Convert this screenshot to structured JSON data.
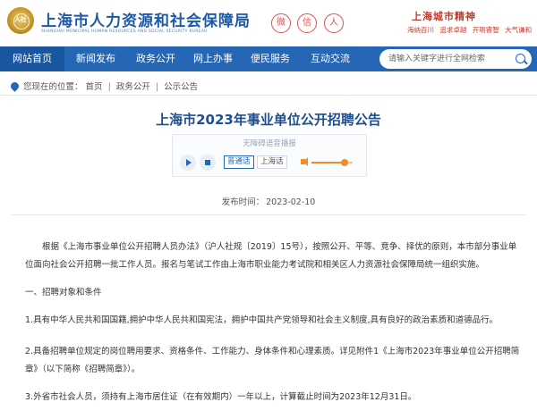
{
  "header": {
    "logo_text": "上海市人力资源和社会保障局",
    "logo_subtitle": "SHANGHAI MUNICIPAL HUMAN RESOURCES AND SOCIAL SECURITY BUREAU",
    "emblem_text": "人社",
    "social_icons": {
      "weibo": "微",
      "wechat": "信",
      "user": "人"
    },
    "spirit_title": "上海城市精神",
    "spirit_items": [
      "海纳百川",
      "追求卓越",
      "开明睿智",
      "大气谦和"
    ]
  },
  "nav": {
    "items": [
      {
        "label": "网站首页",
        "active": true
      },
      {
        "label": "新闻发布",
        "active": false
      },
      {
        "label": "政务公开",
        "active": false
      },
      {
        "label": "网上办事",
        "active": false
      },
      {
        "label": "便民服务",
        "active": false
      },
      {
        "label": "互动交流",
        "active": false
      }
    ],
    "search_placeholder": "请输入关键字进行全网检索"
  },
  "breadcrumb": {
    "label": "您现在的位置：",
    "items": [
      "首页",
      "政务公开",
      "公示公告"
    ],
    "separator": "|"
  },
  "article": {
    "title": "上海市2023年事业单位公开招聘公告",
    "read_panel": {
      "label": "无障碍语音播报",
      "lang_mandarin": "普通话",
      "lang_shanghai": "上海话",
      "volume_fraction": 0.8
    },
    "publish_label": "发布时间：",
    "publish_date": "2023-02-10",
    "paragraphs": [
      "根据《上海市事业单位公开招聘人员办法》（沪人社规〔2019〕15号），按照公开、平等、竞争、择优的原则，本市部分事业单位面向社会公开招聘一批工作人员。报名与笔试工作由上海市职业能力考试院和相关区人力资源社会保障局统一组织实施。",
      "一、招聘对象和条件",
      "1.具有中华人民共和国国籍,拥护中华人民共和国宪法，拥护中国共产党领导和社会主义制度,具有良好的政治素质和道德品行。",
      "2.具备招聘单位规定的岗位聘用要求、资格条件、工作能力、身体条件和心理素质。详见附件1《上海市2023年事业单位公开招聘简章》（以下简称《招聘简章》）。",
      "3.外省市社会人员，须持有上海市居住证（在有效期内）一年以上，计算截止时间为2023年12月31日。"
    ]
  }
}
